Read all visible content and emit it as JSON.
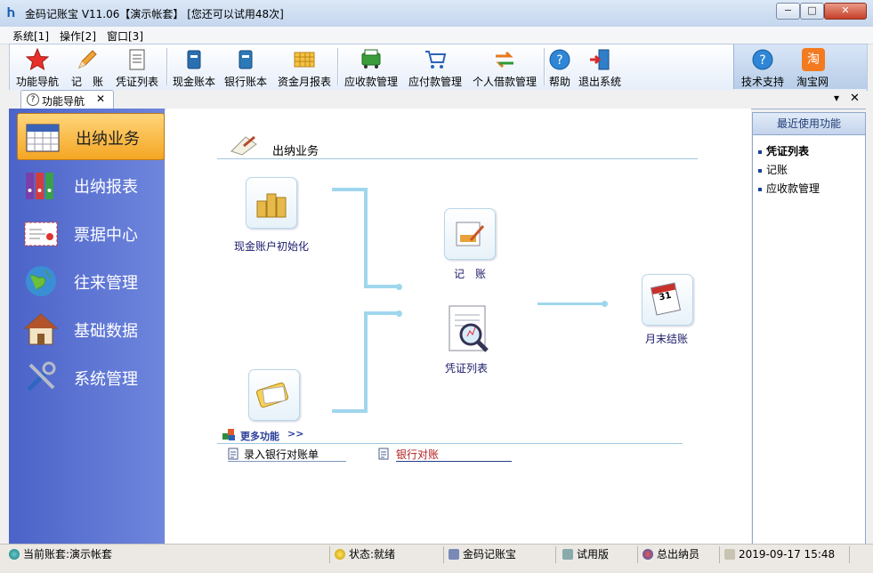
{
  "window": {
    "title": "金码记账宝  V11.06【演示帐套】 [您还可以试用48次]",
    "minimize": "−",
    "maximize": "□",
    "close": "✕"
  },
  "menu": [
    "系统[1]",
    "操作[2]",
    "窗口[3]"
  ],
  "toolbar": {
    "items": [
      {
        "label": "功能导航",
        "icon": "star-icon"
      },
      {
        "label": "记　账",
        "icon": "pencil-icon"
      },
      {
        "label": "凭证列表",
        "icon": "document-icon"
      },
      {
        "label": "现金账本",
        "icon": "cash-book-icon"
      },
      {
        "label": "银行账本",
        "icon": "bank-book-icon"
      },
      {
        "label": "资金月报表",
        "icon": "grid-report-icon"
      },
      {
        "label": "应收款管理",
        "icon": "receivable-icon"
      },
      {
        "label": "应付款管理",
        "icon": "payable-cart-icon"
      },
      {
        "label": "个人借款管理",
        "icon": "exchange-arrows-icon"
      },
      {
        "label": "帮助",
        "icon": "help-icon"
      },
      {
        "label": "退出系统",
        "icon": "exit-door-icon"
      },
      {
        "label": "技术支持",
        "icon": "support-help-icon"
      },
      {
        "label": "淘宝网",
        "icon": "taobao-icon"
      }
    ],
    "taobao_glyph": "淘"
  },
  "tab": {
    "label": "功能导航",
    "close": "✕",
    "help": "?"
  },
  "tab_controls": {
    "dropdown": "▾",
    "close": "✕"
  },
  "leftnav": [
    {
      "label": "出纳业务",
      "active": true
    },
    {
      "label": "出纳报表",
      "active": false
    },
    {
      "label": "票据中心",
      "active": false
    },
    {
      "label": "往来管理",
      "active": false
    },
    {
      "label": "基础数据",
      "active": false
    },
    {
      "label": "系统管理",
      "active": false
    }
  ],
  "main": {
    "section_title": "出纳业务",
    "nodes": {
      "cash_init": "现金账户初始化",
      "bookkeeping": "记　账",
      "voucher_list": "凭证列表",
      "month_end": "月末结账"
    },
    "calendar_day": "31",
    "more_label": "更多功能",
    "more_arrows": ">>",
    "links": [
      "录入银行对账单",
      "银行对账"
    ]
  },
  "recent": {
    "title": "最近使用功能",
    "items": [
      "凭证列表",
      "记账",
      "应收款管理"
    ]
  },
  "status": {
    "account": "当前账套:演示帐套",
    "state": "状态:就绪",
    "app": "金码记账宝",
    "edition": "试用版",
    "user": "总出纳员",
    "datetime": "2019-09-17  15:48"
  },
  "colors": {
    "nav_bg": "#5a72d2",
    "nav_active": "#f4a623",
    "flow_line": "#9fd6ee",
    "close_red": "#c6402a"
  }
}
